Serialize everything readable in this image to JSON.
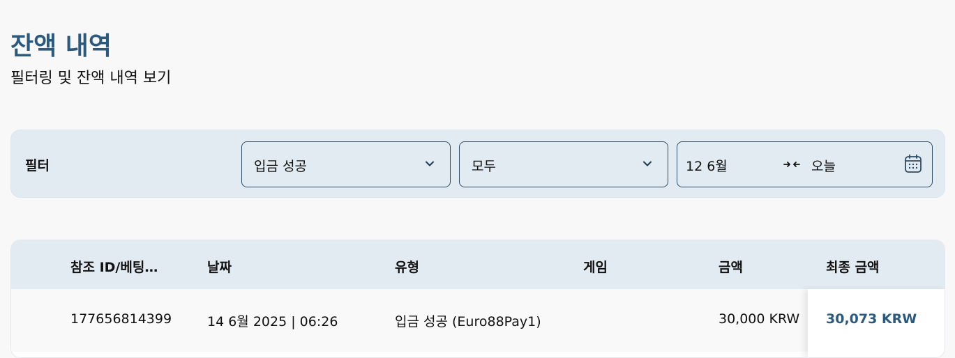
{
  "page": {
    "title": "잔액 내역",
    "subtitle": "필터링 및 잔액 내역 보기"
  },
  "filter": {
    "label": "필터",
    "status_value": "입금 성공",
    "game_value": "모두",
    "date_from": "12 6월",
    "date_to": "오늘"
  },
  "table": {
    "headers": {
      "ref": "참조 ID/베팅…",
      "date": "날짜",
      "type": "유형",
      "game": "게임",
      "amount": "금액",
      "final": "최종 금액"
    },
    "rows": [
      {
        "ref": "177656814399",
        "date": "14 6월 2025 | 06:26",
        "type": "입금 성공 (Euro88Pay1)",
        "game": "",
        "amount": "30,000 KRW",
        "final": "30,073 KRW"
      }
    ]
  },
  "colors": {
    "accent": "#2c5a7f",
    "panel": "#e2eaf2",
    "border": "#2c4a63"
  }
}
